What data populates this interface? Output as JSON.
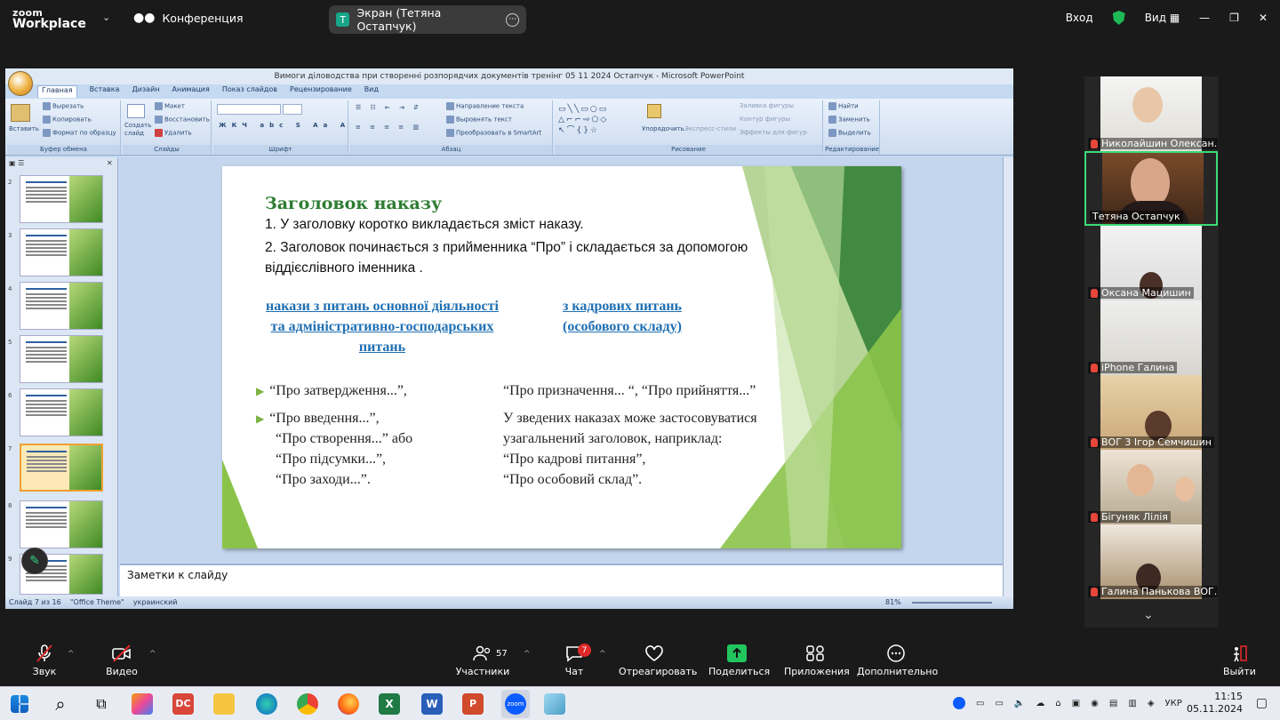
{
  "zoom": {
    "logo_line1": "zoom",
    "logo_line2": "Workplace",
    "meeting_label": "Конференция",
    "share_badge": "T",
    "share_label": "Экран (Тетяна Остапчук)",
    "signin_label": "Вход",
    "view_label": "Вид"
  },
  "ppt": {
    "window_title": "Вимоги діловодства при створенні розпорядчих документів тренінг 05 11 2024 Остапчук - Microsoft PowerPoint",
    "tabs": [
      "Главная",
      "Вставка",
      "Дизайн",
      "Анимация",
      "Показ слайдов",
      "Рецензирование",
      "Вид"
    ],
    "ribbon": {
      "clipboard": {
        "paste": "Вставить",
        "cut": "Вырезать",
        "copy": "Копировать",
        "format": "Формат по образцу",
        "label": "Буфер обмена"
      },
      "slides": {
        "create": "Создать слайд",
        "layout": "Макет",
        "reset": "Восстановить",
        "delete": "Удалить",
        "label": "Слайды"
      },
      "font": {
        "label": "Шрифт"
      },
      "paragraph": {
        "text_dir": "Направление текста",
        "align": "Выровнять текст",
        "smartart": "Преобразовать в SmartArt",
        "label": "Абзац"
      },
      "drawing": {
        "arrange": "Упорядочить",
        "styles": "Экспресс-стили",
        "fill": "Заливка фигуры",
        "outline": "Контур фигуры",
        "effects": "Эффекты для фигур",
        "label": "Рисование"
      },
      "editing": {
        "find": "Найти",
        "replace": "Заменить",
        "select": "Выделить",
        "label": "Редактирование"
      }
    },
    "thumb_numbers": [
      "2",
      "3",
      "4",
      "5",
      "6",
      "7",
      "8",
      "9"
    ],
    "notes_placeholder": "Заметки к слайду",
    "status": {
      "slide": "Слайд 7 из 16",
      "theme": "\"Office Theme\"",
      "lang": "украинский",
      "zoom": "81%"
    }
  },
  "slide": {
    "title": "Заголовок наказу",
    "line1": "1. У заголовку коротко викладається зміст наказу.",
    "line2": "2. Заголовок починається з прийменника “Про” і складається за допомогою віддієслівного іменника .",
    "col_a": "накази з питань основної діяльності та адміністративно-господарських питань",
    "col_b": "з кадрових питань (особового складу)",
    "left_rows": [
      "“Про затвердження...”,",
      "“Про введення...”,",
      "“Про створення...” або",
      "“Про підсумки...”,",
      "“Про заходи...”."
    ],
    "right_rows": [
      "“Про призначення... “, “Про прийняття...”",
      "У зведених наказах може застосовуватися",
      "узагальнений заголовок, наприклад:",
      "“Про кадрові питання”,",
      "“Про особовий склад”."
    ]
  },
  "participants": [
    {
      "name": "Николайшин Олексан...",
      "muted": true
    },
    {
      "name": "Тетяна Остапчук",
      "muted": false,
      "active": true
    },
    {
      "name": "Оксана Мацишин",
      "muted": true
    },
    {
      "name": "iPhone Галина",
      "muted": true
    },
    {
      "name": "ВОГ 3 Ігор Семчишин",
      "muted": true
    },
    {
      "name": "Бігуняк Лілія",
      "muted": true
    },
    {
      "name": "Галина Панькова ВОГ...",
      "muted": true
    }
  ],
  "toolbar": {
    "audio": "Звук",
    "video": "Видео",
    "participants": "Участники",
    "participants_count": "57",
    "chat": "Чат",
    "chat_badge": "7",
    "react": "Отреагировать",
    "share": "Поделиться",
    "apps": "Приложения",
    "more": "Дополнительно",
    "leave": "Выйти"
  },
  "taskbar": {
    "lang": "УКР",
    "time": "11:15",
    "date": "05.11.2024"
  },
  "colors": {
    "zoom_bg": "#1a1a1a",
    "slide_green": "#7cb342",
    "slide_title": "#2e7d32",
    "slide_blue": "#1f6fb3",
    "active_speaker": "#3bdc78",
    "mute_red": "#e8463b"
  }
}
